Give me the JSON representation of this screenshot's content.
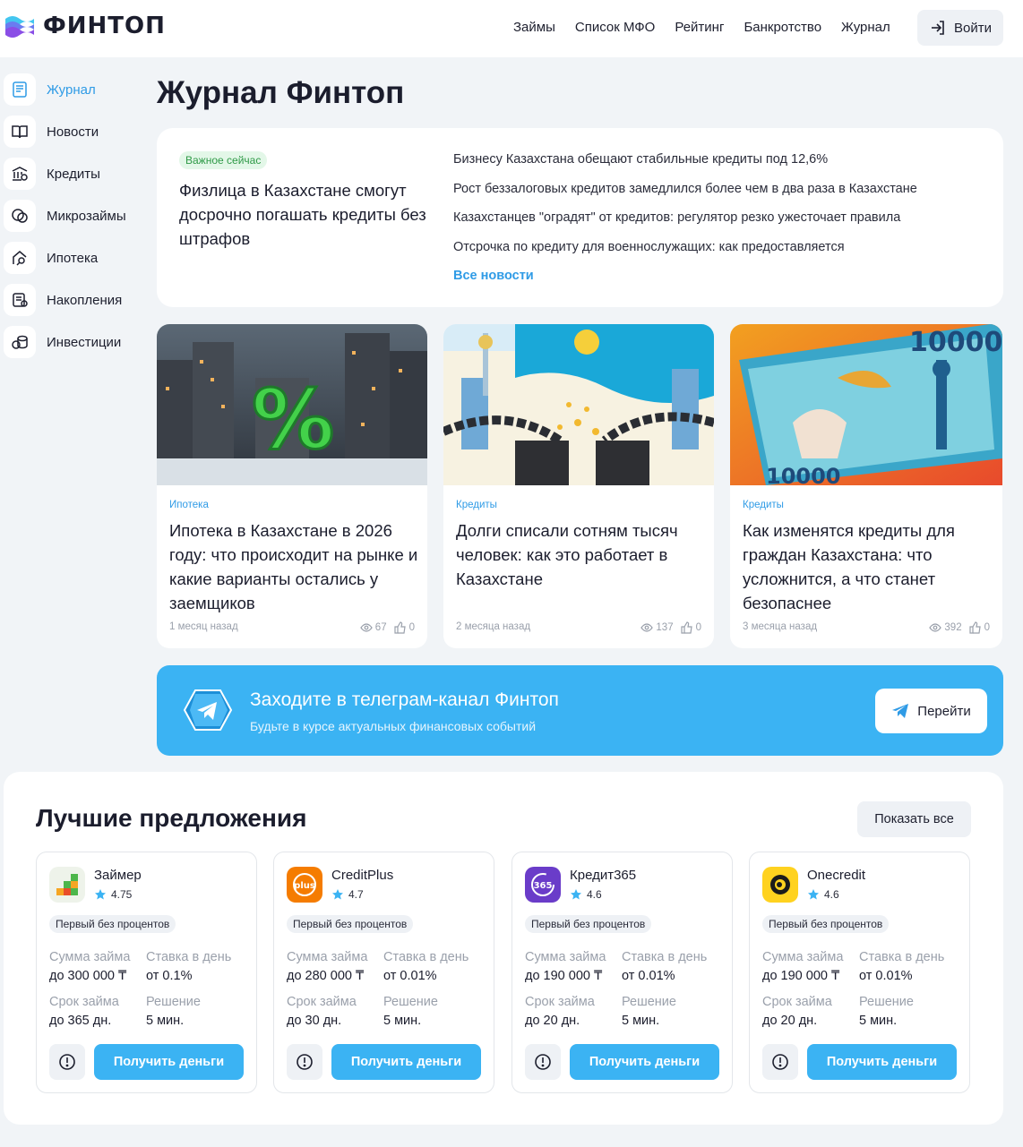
{
  "header": {
    "logo_text": "ФИНТОП",
    "nav": [
      "Займы",
      "Список МФО",
      "Рейтинг",
      "Банкротство",
      "Журнал"
    ],
    "login_label": "Войти"
  },
  "sidebar": {
    "items": [
      {
        "label": "Журнал",
        "icon": "journal-icon"
      },
      {
        "label": "Новости",
        "icon": "book-icon"
      },
      {
        "label": "Кредиты",
        "icon": "bank-icon"
      },
      {
        "label": "Микрозаймы",
        "icon": "coins-icon"
      },
      {
        "label": "Ипотека",
        "icon": "house-key-icon"
      },
      {
        "label": "Накопления",
        "icon": "savings-icon"
      },
      {
        "label": "Инвестиции",
        "icon": "investments-icon"
      }
    ]
  },
  "page_title": "Журнал Финтоп",
  "featured": {
    "badge": "Важное сейчас",
    "title": "Физлица в Казахстане смогут досрочно погашать кредиты без штрафов",
    "news": [
      "Бизнесу Казахстана обещают стабильные кредиты под 12,6%",
      "Рост беззалоговых кредитов замедлился более чем в два раза в Казахстане",
      "Казахстанцев \"оградят\" от кредитов: регулятор резко ужесточает правила",
      "Отсрочка по кредиту для военнослужащих: как предоставляется"
    ],
    "all_news": "Все новости"
  },
  "articles": [
    {
      "category": "Ипотека",
      "title": "Ипотека в Казахстане в 2026 году: что происходит на рынке и какие варианты остались у заемщиков",
      "time": "1 месяц назад",
      "views": "67",
      "likes": "0"
    },
    {
      "category": "Кредиты",
      "title": "Долги списали сотням тысяч человек: как это работает в Казахстане",
      "time": "2 месяца назад",
      "views": "137",
      "likes": "0"
    },
    {
      "category": "Кредиты",
      "title": "Как изменятся кредиты для граждан Казахстана: что усложнится, а что станет безопаснее",
      "time": "3 месяца назад",
      "views": "392",
      "likes": "0"
    }
  ],
  "telegram": {
    "title": "Заходите в телеграм-канал Финтоп",
    "subtitle": "Будьте в курсе актуальных финансовых событий",
    "button": "Перейти"
  },
  "offers": {
    "title": "Лучшие предложения",
    "show_all": "Показать все",
    "labels": {
      "sum": "Сумма займа",
      "rate": "Ставка в день",
      "term": "Срок займа",
      "decision": "Решение"
    },
    "get_money": "Получить деньги",
    "items": [
      {
        "name": "Займер",
        "rating": "4.75",
        "tag": "Первый без процентов",
        "sum": "до 300 000 ₸",
        "rate": "от 0.1%",
        "term": "до 365 дн.",
        "decision": "5 мин."
      },
      {
        "name": "CreditPlus",
        "rating": "4.7",
        "tag": "Первый без процентов",
        "sum": "до 280 000 ₸",
        "rate": "от 0.01%",
        "term": "до 30 дн.",
        "decision": "5 мин."
      },
      {
        "name": "Кредит365",
        "rating": "4.6",
        "tag": "Первый без процентов",
        "sum": "до 190 000 ₸",
        "rate": "от 0.01%",
        "term": "до 20 дн.",
        "decision": "5 мин."
      },
      {
        "name": "Onecredit",
        "rating": "4.6",
        "tag": "Первый без процентов",
        "sum": "до 190 000 ₸",
        "rate": "от 0.01%",
        "term": "до 20 дн.",
        "decision": "5 мин."
      }
    ]
  },
  "colors": {
    "accent": "#3bb3f3",
    "link": "#2f9be6",
    "badge_green": "#2f9a47",
    "background": "#f1f4f7"
  }
}
